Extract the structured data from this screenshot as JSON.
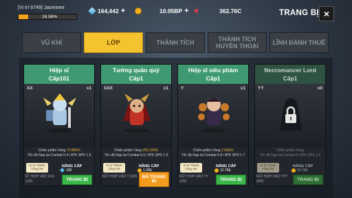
{
  "player": {
    "name": "[Vị trí 6749] Jasminee",
    "xp_percent": "16.56%",
    "xp_fraction": 0.1656
  },
  "resources": {
    "gems": "164,442",
    "gold": "10.05BP",
    "hearts": "362.76C"
  },
  "header": {
    "title": "TRANG BỊ",
    "close": "×"
  },
  "tabs": [
    {
      "label": "VŨ KHÍ",
      "active": false
    },
    {
      "label": "LỚP",
      "active": true
    },
    {
      "label": "THÀNH TÍCH",
      "active": false
    },
    {
      "label": "THÀNH TÍCH HUYỀN THOẠI",
      "active": false
    },
    {
      "label": "LĨNH ĐÁNH THUÊ",
      "active": false
    }
  ],
  "cards": [
    {
      "name": "Hiệp sĩ",
      "level": "Cấp101",
      "tier": "XX",
      "count": "x1",
      "stat1_label": "Chiến phẩm Vàng",
      "stat1_value": "72.980%",
      "stat2": "Tốc độ Nạp lại Combat 5.4 / ATK SPD 1.5",
      "tag": "Vị trí Thành công 0%",
      "upgrade_label": "NÂNG CẤP",
      "upgrade_cost": "100",
      "cost_type": "gem",
      "merge": "ẾT HỢP VÀO XXX (1/5)",
      "equip": "TRANG BỊ",
      "equip_style": "green"
    },
    {
      "name": "Tướng quân quỷ",
      "level": "Cấp1",
      "tier": "XXX",
      "count": "x1",
      "stat1_label": "Chiến phẩm Vàng",
      "stat1_value": "255.150%",
      "stat2": "Tốc độ Nạp lại Combat 5.6 / ATK SPD 1.6",
      "tag": "Vị trí Thành công 0%",
      "upgrade_label": "NÂNG CẤP",
      "upgrade_cost": "1.28E",
      "cost_type": "gold",
      "merge": "KẾT HỢP VÀO Y (0/5)",
      "equip": "ĐÃ TRANG BỊ",
      "equip_style": "orange"
    },
    {
      "name": "Hiệp sĩ siêu phàm",
      "level": "Cấp1",
      "tier": "Y",
      "count": "x1",
      "stat1_label": "Chiến phẩm Vàng",
      "stat1_value": "2.55E%",
      "stat2": "Tốc độ Nạp lại Combat 5.8 / ATK SPD 1.7",
      "tag": "Vị trí Thành công 0%",
      "upgrade_label": "NÂNG CẤP",
      "upgrade_cost": "12.76E",
      "cost_type": "gold",
      "merge": "KẾT HỢP VÀO YY (1/5)",
      "equip": "TRANG BỊ",
      "equip_style": "green"
    },
    {
      "name": "Necromancer Lord",
      "level": "Cấp1",
      "tier": "YY",
      "count": "x0",
      "stat1_label": "Chiến phẩm Vàng",
      "stat1_value": "",
      "stat2": "Tốc độ Nạp lại Combat 6 / ATK SPD 1.9",
      "tag": "Vị trí Thành công 0%",
      "upgrade_label": "NÂNG CẤP",
      "upgrade_cost": "63.79E",
      "cost_type": "gold",
      "merge": "KẾT HỢP VÀO YYY (0/5)",
      "equip": "TRANG BỊ",
      "equip_style": "dim"
    }
  ],
  "colors": {
    "accent_tab": "#f6c330",
    "card_head": "#3f9a72",
    "equip_green": "#3cb54a",
    "equip_orange": "#f29b1e",
    "xp_fill": "#f2a31b"
  }
}
